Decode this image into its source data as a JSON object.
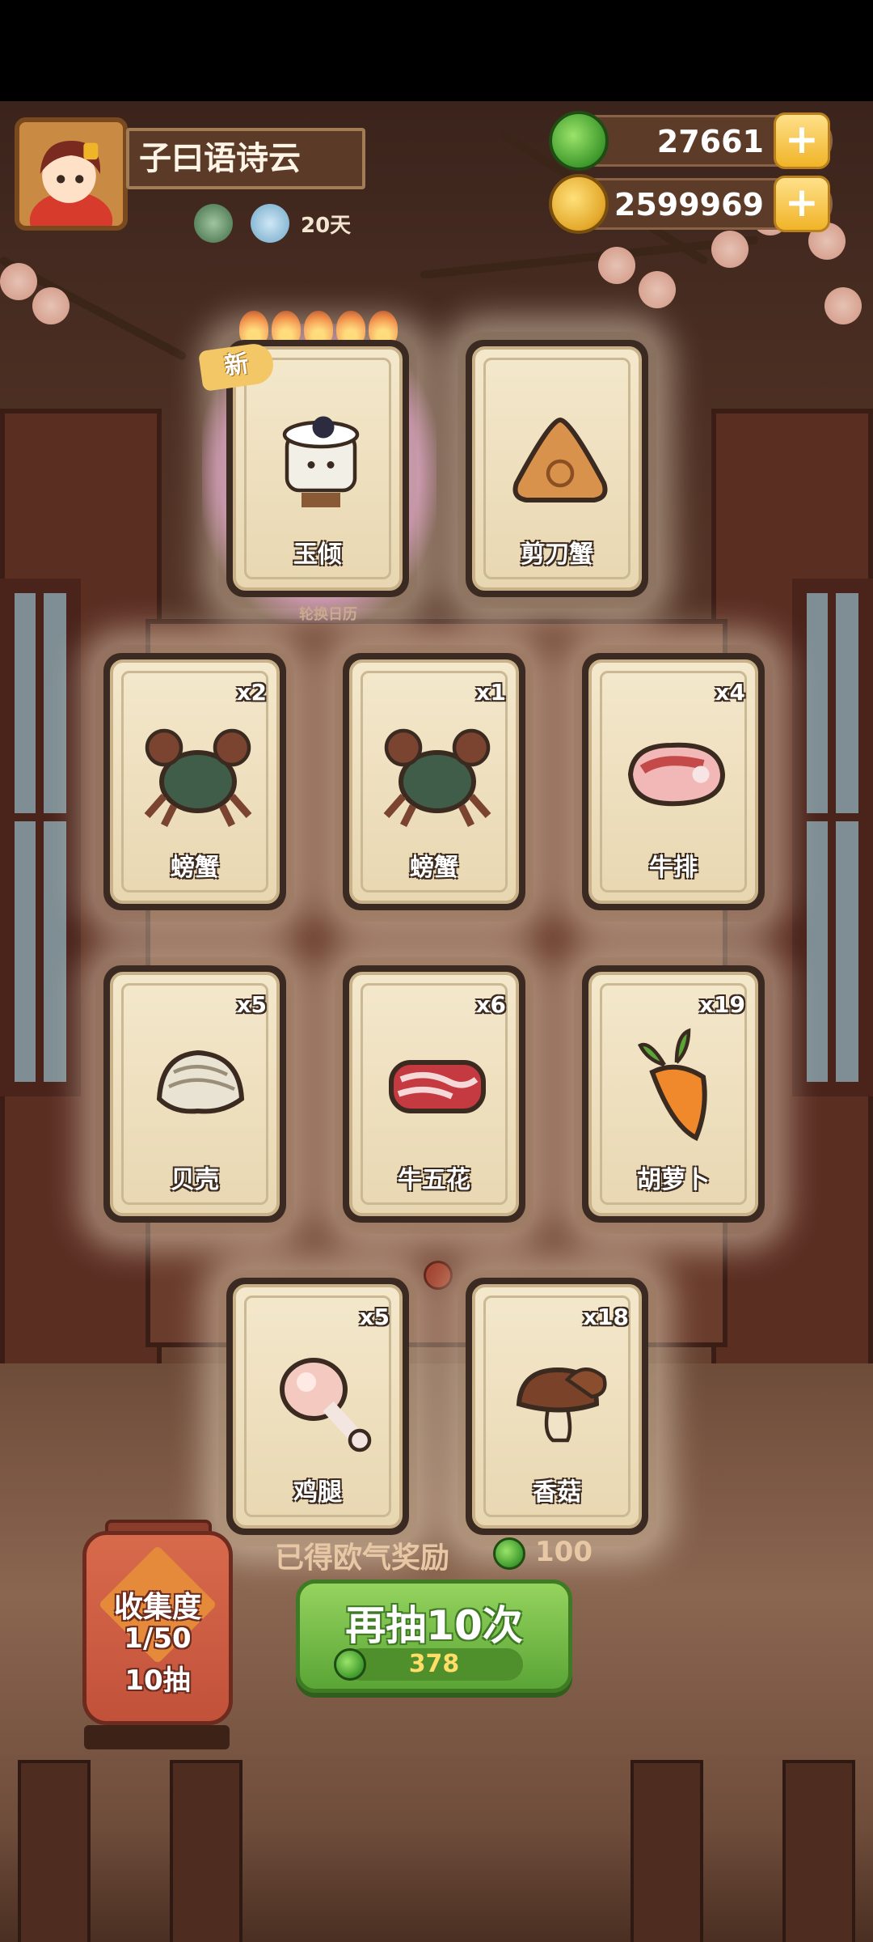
{
  "player": {
    "name": "子曰语诗云",
    "days": "20天"
  },
  "currency": {
    "jade": "27661",
    "coins": "2599969",
    "plus_label": "+"
  },
  "colors": {
    "accent_green": "#5aa536",
    "card_bg": "#f4e8cc",
    "gold": "#f0b428"
  },
  "featured": {
    "new_badge": "新",
    "calendar_label": "轮换日历",
    "flame_level": 5
  },
  "cards": [
    {
      "label": "玉倾",
      "count": "",
      "icon": "jade-cup-character-icon"
    },
    {
      "label": "剪刀蟹",
      "count": "",
      "icon": "scissor-crab-icon"
    },
    {
      "label": "螃蟹",
      "count": "x2",
      "icon": "crab-icon"
    },
    {
      "label": "螃蟹",
      "count": "x1",
      "icon": "crab-icon"
    },
    {
      "label": "牛排",
      "count": "x4",
      "icon": "steak-icon"
    },
    {
      "label": "贝壳",
      "count": "x5",
      "icon": "clam-icon"
    },
    {
      "label": "牛五花",
      "count": "x6",
      "icon": "beef-belly-icon"
    },
    {
      "label": "胡萝卜",
      "count": "x19",
      "icon": "carrot-icon"
    },
    {
      "label": "鸡腿",
      "count": "x5",
      "icon": "chicken-leg-icon"
    },
    {
      "label": "香菇",
      "count": "x18",
      "icon": "mushroom-icon"
    }
  ],
  "collection": {
    "title": "收集度",
    "progress": "1/50",
    "draws": "10抽"
  },
  "reward": {
    "text": "已得欧气奖励",
    "value": "100"
  },
  "draw_button": {
    "label": "再抽10次",
    "cost": "378"
  }
}
